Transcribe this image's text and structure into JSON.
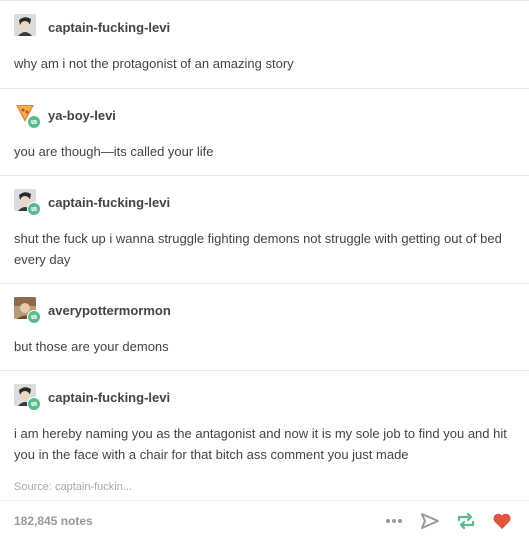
{
  "posts": [
    {
      "username": "captain-fucking-levi",
      "text": "why am i not the protagonist of an amazing story",
      "reblog": false
    },
    {
      "username": "ya-boy-levi",
      "text": "you are though—its called your life",
      "reblog": true
    },
    {
      "username": "captain-fucking-levi",
      "text": "shut the fuck up i wanna struggle fighting demons not struggle with getting out of bed every day",
      "reblog": true
    },
    {
      "username": "averypottermormon",
      "text": "but those are your demons",
      "reblog": true
    },
    {
      "username": "captain-fucking-levi",
      "text": "i am hereby naming you as the antagonist and now it is my sole job to find you and hit you in the face with a chair for that bitch ass comment you just made",
      "reblog": true
    }
  ],
  "source": {
    "label": "Source: captain-fuckin..."
  },
  "footer": {
    "notes": "182,845 notes",
    "icons": [
      "more-icon",
      "share-icon",
      "reblog-icon",
      "like-icon"
    ]
  },
  "colors": {
    "reblog_green": "#56bc8a",
    "like_red": "#e2553d",
    "text": "#444444",
    "muted": "#999999"
  }
}
